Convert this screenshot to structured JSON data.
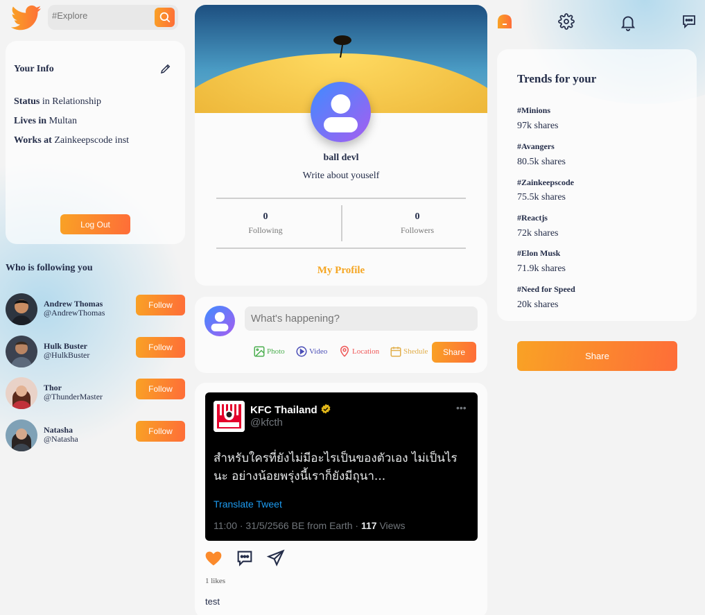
{
  "search": {
    "placeholder": "#Explore"
  },
  "info": {
    "title": "Your Info",
    "rows": [
      {
        "label": "Status",
        "value": " in Relationship"
      },
      {
        "label": "Lives in",
        "value": " Multan"
      },
      {
        "label": "Works at",
        "value": " Zainkeepscode inst"
      }
    ],
    "logout_label": "Log Out"
  },
  "followers": {
    "title": "Who is following you",
    "follow_label": "Follow",
    "items": [
      {
        "name": "Andrew Thomas",
        "username": "@AndrewThomas"
      },
      {
        "name": "Hulk Buster",
        "username": "@HulkBuster"
      },
      {
        "name": "Thor",
        "username": "@ThunderMaster"
      },
      {
        "name": "Natasha",
        "username": "@Natasha"
      }
    ]
  },
  "profile": {
    "name": "ball devl",
    "bio": "Write about youself",
    "following_count": "0",
    "following_label": "Following",
    "followers_count": "0",
    "followers_label": "Followers",
    "link_label": "My Profile"
  },
  "composer": {
    "placeholder": "What's happening?",
    "options": [
      {
        "label": "Photo",
        "color": "#4caf50"
      },
      {
        "label": "Video",
        "color": "#4a4eb7"
      },
      {
        "label": "Location",
        "color": "#ef5757"
      },
      {
        "label": "Shedule",
        "color": "#e1ae4a"
      }
    ],
    "share_label": "Share"
  },
  "post": {
    "tweet": {
      "name": "KFC Thailand",
      "handle": "@kfcth",
      "text": "สำหรับใครที่ยังไม่มีอะไรเป็นของตัวเอง ไม่เป็นไรนะ อย่างน้อยพรุ่งนี้เราก็ยังมีถุนา...",
      "translate": "Translate Tweet",
      "meta_prefix": "11:00 · 31/5/2566 BE from Earth · ",
      "views_count": "117",
      "views_label": " Views"
    },
    "likes": "1 likes",
    "caption": "test"
  },
  "trends": {
    "title": "Trends for your",
    "items": [
      {
        "tag": "#Minions",
        "shares": "97k shares"
      },
      {
        "tag": "#Avangers",
        "shares": "80.5k shares"
      },
      {
        "tag": "#Zainkeepscode",
        "shares": "75.5k shares"
      },
      {
        "tag": "#Reactjs",
        "shares": "72k shares"
      },
      {
        "tag": "#Elon Musk",
        "shares": "71.9k shares"
      },
      {
        "tag": "#Need for Speed",
        "shares": "20k shares"
      }
    ]
  },
  "share_button_label": "Share",
  "colors": {
    "accent_start": "#f9a225",
    "accent_end": "#fe6d38",
    "profile_link": "#f5a623"
  }
}
